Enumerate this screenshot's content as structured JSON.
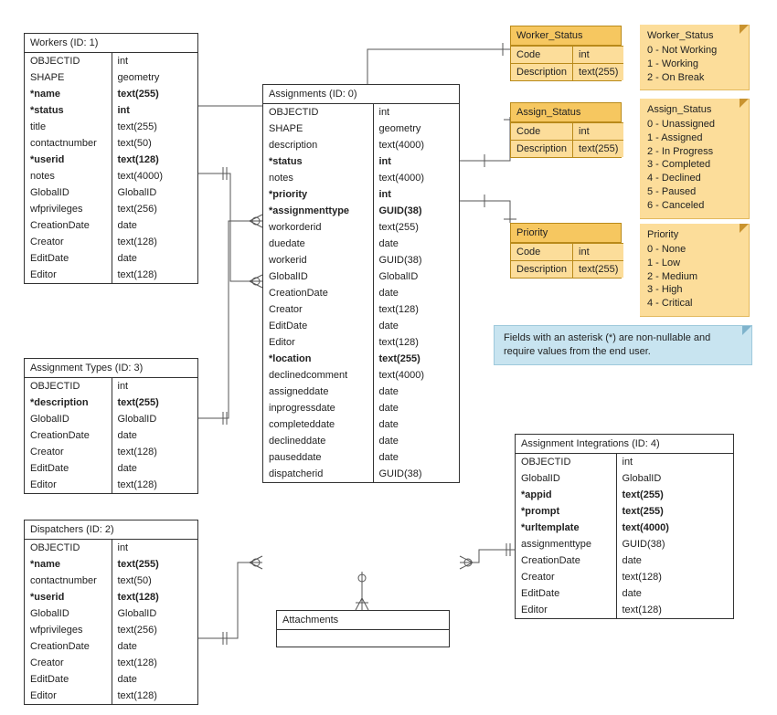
{
  "entities": {
    "workers": {
      "title": "Workers (ID: 1)",
      "fields": [
        {
          "name": "OBJECTID",
          "type": "int",
          "bold": false
        },
        {
          "name": "SHAPE",
          "type": "geometry",
          "bold": false
        },
        {
          "name": "*name",
          "type": "text(255)",
          "bold": true
        },
        {
          "name": "*status",
          "type": "int",
          "bold": true
        },
        {
          "name": "title",
          "type": "text(255)",
          "bold": false
        },
        {
          "name": "contactnumber",
          "type": "text(50)",
          "bold": false
        },
        {
          "name": "*userid",
          "type": "text(128)",
          "bold": true
        },
        {
          "name": "notes",
          "type": "text(4000)",
          "bold": false
        },
        {
          "name": "GlobalID",
          "type": "GlobalID",
          "bold": false
        },
        {
          "name": "wfprivileges",
          "type": "text(256)",
          "bold": false
        },
        {
          "name": "CreationDate",
          "type": "date",
          "bold": false
        },
        {
          "name": "Creator",
          "type": "text(128)",
          "bold": false
        },
        {
          "name": "EditDate",
          "type": "date",
          "bold": false
        },
        {
          "name": "Editor",
          "type": "text(128)",
          "bold": false
        }
      ]
    },
    "assignment_types": {
      "title": "Assignment Types (ID: 3)",
      "fields": [
        {
          "name": "OBJECTID",
          "type": "int",
          "bold": false
        },
        {
          "name": "*description",
          "type": "text(255)",
          "bold": true
        },
        {
          "name": "GlobalID",
          "type": "GlobalID",
          "bold": false
        },
        {
          "name": "CreationDate",
          "type": "date",
          "bold": false
        },
        {
          "name": "Creator",
          "type": "text(128)",
          "bold": false
        },
        {
          "name": "EditDate",
          "type": "date",
          "bold": false
        },
        {
          "name": "Editor",
          "type": "text(128)",
          "bold": false
        }
      ]
    },
    "dispatchers": {
      "title": "Dispatchers (ID: 2)",
      "fields": [
        {
          "name": "OBJECTID",
          "type": "int",
          "bold": false
        },
        {
          "name": "*name",
          "type": "text(255)",
          "bold": true
        },
        {
          "name": "contactnumber",
          "type": "text(50)",
          "bold": false
        },
        {
          "name": "*userid",
          "type": "text(128)",
          "bold": true
        },
        {
          "name": "GlobalID",
          "type": "GlobalID",
          "bold": false
        },
        {
          "name": "wfprivileges",
          "type": "text(256)",
          "bold": false
        },
        {
          "name": "CreationDate",
          "type": "date",
          "bold": false
        },
        {
          "name": "Creator",
          "type": "text(128)",
          "bold": false
        },
        {
          "name": "EditDate",
          "type": "date",
          "bold": false
        },
        {
          "name": "Editor",
          "type": "text(128)",
          "bold": false
        }
      ]
    },
    "assignments": {
      "title": "Assignments (ID: 0)",
      "fields": [
        {
          "name": "OBJECTID",
          "type": "int",
          "bold": false
        },
        {
          "name": "SHAPE",
          "type": "geometry",
          "bold": false
        },
        {
          "name": "description",
          "type": "text(4000)",
          "bold": false
        },
        {
          "name": "*status",
          "type": "int",
          "bold": true
        },
        {
          "name": "notes",
          "type": "text(4000)",
          "bold": false
        },
        {
          "name": "*priority",
          "type": "int",
          "bold": true
        },
        {
          "name": "*assignmenttype",
          "type": "GUID(38)",
          "bold": true
        },
        {
          "name": "workorderid",
          "type": "text(255)",
          "bold": false
        },
        {
          "name": "duedate",
          "type": "date",
          "bold": false
        },
        {
          "name": "workerid",
          "type": "GUID(38)",
          "bold": false
        },
        {
          "name": "GlobalID",
          "type": "GlobalID",
          "bold": false
        },
        {
          "name": "CreationDate",
          "type": "date",
          "bold": false
        },
        {
          "name": "Creator",
          "type": "text(128)",
          "bold": false
        },
        {
          "name": "EditDate",
          "type": "date",
          "bold": false
        },
        {
          "name": "Editor",
          "type": "text(128)",
          "bold": false
        },
        {
          "name": "*location",
          "type": "text(255)",
          "bold": true
        },
        {
          "name": "declinedcomment",
          "type": "text(4000)",
          "bold": false
        },
        {
          "name": "assigneddate",
          "type": "date",
          "bold": false
        },
        {
          "name": "inprogressdate",
          "type": "date",
          "bold": false
        },
        {
          "name": "completeddate",
          "type": "date",
          "bold": false
        },
        {
          "name": "declineddate",
          "type": "date",
          "bold": false
        },
        {
          "name": "pauseddate",
          "type": "date",
          "bold": false
        },
        {
          "name": "dispatcherid",
          "type": "GUID(38)",
          "bold": false
        }
      ]
    },
    "attachments": {
      "title": "Attachments"
    },
    "assignment_integrations": {
      "title": "Assignment Integrations (ID: 4)",
      "fields": [
        {
          "name": "OBJECTID",
          "type": "int",
          "bold": false
        },
        {
          "name": "GlobalID",
          "type": "GlobalID",
          "bold": false
        },
        {
          "name": "*appid",
          "type": "text(255)",
          "bold": true
        },
        {
          "name": "*prompt",
          "type": "text(255)",
          "bold": true
        },
        {
          "name": "*urltemplate",
          "type": "text(4000)",
          "bold": true
        },
        {
          "name": "assignmenttype",
          "type": "GUID(38)",
          "bold": false
        },
        {
          "name": "CreationDate",
          "type": "date",
          "bold": false
        },
        {
          "name": "Creator",
          "type": "text(128)",
          "bold": false
        },
        {
          "name": "EditDate",
          "type": "date",
          "bold": false
        },
        {
          "name": "Editor",
          "type": "text(128)",
          "bold": false
        }
      ]
    }
  },
  "domains": {
    "worker_status": {
      "title": "Worker_Status",
      "fields": [
        {
          "name": "Code",
          "type": "int"
        },
        {
          "name": "Description",
          "type": "text(255)"
        }
      ]
    },
    "assign_status": {
      "title": "Assign_Status",
      "fields": [
        {
          "name": "Code",
          "type": "int"
        },
        {
          "name": "Description",
          "type": "text(255)"
        }
      ]
    },
    "priority": {
      "title": "Priority",
      "fields": [
        {
          "name": "Code",
          "type": "int"
        },
        {
          "name": "Description",
          "type": "text(255)"
        }
      ]
    }
  },
  "notes": {
    "worker_status": {
      "title": "Worker_Status",
      "lines": [
        "0 - Not Working",
        "1 - Working",
        "2 - On Break"
      ]
    },
    "assign_status": {
      "title": "Assign_Status",
      "lines": [
        "0 - Unassigned",
        "1 - Assigned",
        "2 - In Progress",
        "3 - Completed",
        "4 - Declined",
        "5 - Paused",
        "6 - Canceled"
      ]
    },
    "priority": {
      "title": "Priority",
      "lines": [
        "0 - None",
        "1 - Low",
        "2 - Medium",
        "3 - High",
        "4 - Critical"
      ]
    },
    "asterisk_info": "Fields with an asterisk (*) are non-nullable and require values from the end user."
  },
  "field_col_widths": {
    "workers": 95,
    "assignment_types": 95,
    "dispatchers": 95,
    "assignments": 120,
    "assignment_integrations": 110
  },
  "domain_col_width": 66
}
